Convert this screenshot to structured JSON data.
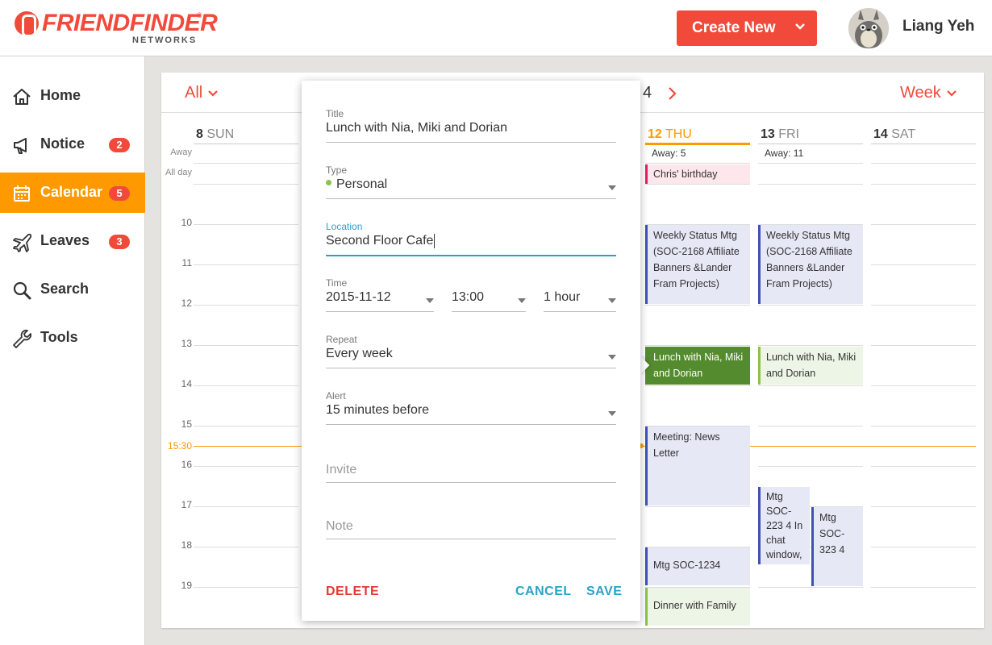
{
  "brand": {
    "name": "FRIENDFINDER",
    "sub": "NETWORKS",
    "reg": "®",
    "color": "#f24a3a"
  },
  "header": {
    "create_label": "Create New",
    "user_name": "Liang Yeh"
  },
  "sidebar": {
    "items": [
      {
        "label": "Home",
        "icon": "home-icon",
        "badge": null
      },
      {
        "label": "Notice",
        "icon": "megaphone-icon",
        "badge": "2"
      },
      {
        "label": "Calendar",
        "icon": "calendar-icon",
        "badge": "5",
        "active": true
      },
      {
        "label": "Leaves",
        "icon": "airplane-icon",
        "badge": "3"
      },
      {
        "label": "Search",
        "icon": "search-icon",
        "badge": null
      },
      {
        "label": "Tools",
        "icon": "wrench-icon",
        "badge": null
      }
    ],
    "active_color": "#ff9900"
  },
  "calendar": {
    "filter": "All",
    "range_fragment": "4",
    "view": "Week",
    "away_label": "Away",
    "allday_label": "All day",
    "days": [
      {
        "num": "8",
        "name": "SUN",
        "away": ""
      },
      {
        "num": "12",
        "name": "THU",
        "away": "Away: 5",
        "today": true
      },
      {
        "num": "13",
        "name": "FRI",
        "away": "Away: 11"
      },
      {
        "num": "14",
        "name": "SAT",
        "away": ""
      }
    ],
    "hours": [
      "10",
      "11",
      "12",
      "13",
      "14",
      "15",
      "16",
      "17",
      "18",
      "19"
    ],
    "now_label": "15:30",
    "events": {
      "allday_thu": "Chris' birthday",
      "weekly_thu": "Weekly Status Mtg (SOC-2168 Affiliate Banners &Lander Fram Projects)",
      "weekly_fri": "Weekly Status Mtg (SOC-2168 Affiliate Banners &Lander Fram Projects)",
      "lunch_thu": "Lunch with Nia, Miki and Dorian",
      "lunch_fri": "Lunch with Nia, Miki and Dorian",
      "news_thu": "Meeting: News Letter",
      "soc2234_fri": "Mtg SOC-223 4 In chat window, ...",
      "soc3234_fri": "Mtg SOC-323 4",
      "soc1234_thu": "Mtg SOC-1234",
      "dinner_thu": "Dinner with Family"
    }
  },
  "form": {
    "title_label": "Title",
    "title_value": "Lunch with Nia, Miki and Dorian",
    "type_label": "Type",
    "type_value": "Personal",
    "location_label": "Location",
    "location_value": "Second Floor Cafe",
    "time_label": "Time",
    "date_value": "2015-11-12",
    "time_value": "13:00",
    "duration_value": "1 hour",
    "repeat_label": "Repeat",
    "repeat_value": "Every week",
    "alert_label": "Alert",
    "alert_value": "15 minutes before",
    "invite_placeholder": "Invite",
    "note_placeholder": "Note",
    "delete_label": "DELETE",
    "cancel_label": "CANCEL",
    "save_label": "SAVE"
  }
}
